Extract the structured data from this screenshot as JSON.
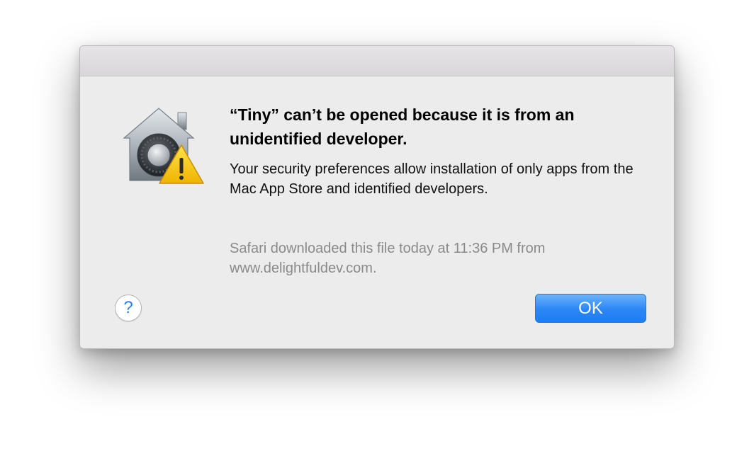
{
  "dialog": {
    "title": "“Tiny” can’t be opened because it is from an unidentified developer.",
    "message": "Your security preferences allow installation of only apps from the Mac App Store and identified developers.",
    "source_note": "Safari downloaded this file today at 11:36 PM from www.delightfuldev.com.",
    "help_label": "?",
    "ok_label": "OK",
    "icon": "gatekeeper-security-warning-icon"
  },
  "colors": {
    "ok_button": "#2b86f5",
    "help_glyph": "#2e7bf0",
    "warning_triangle": "#f5c400",
    "source_text": "#8a8a8a"
  }
}
